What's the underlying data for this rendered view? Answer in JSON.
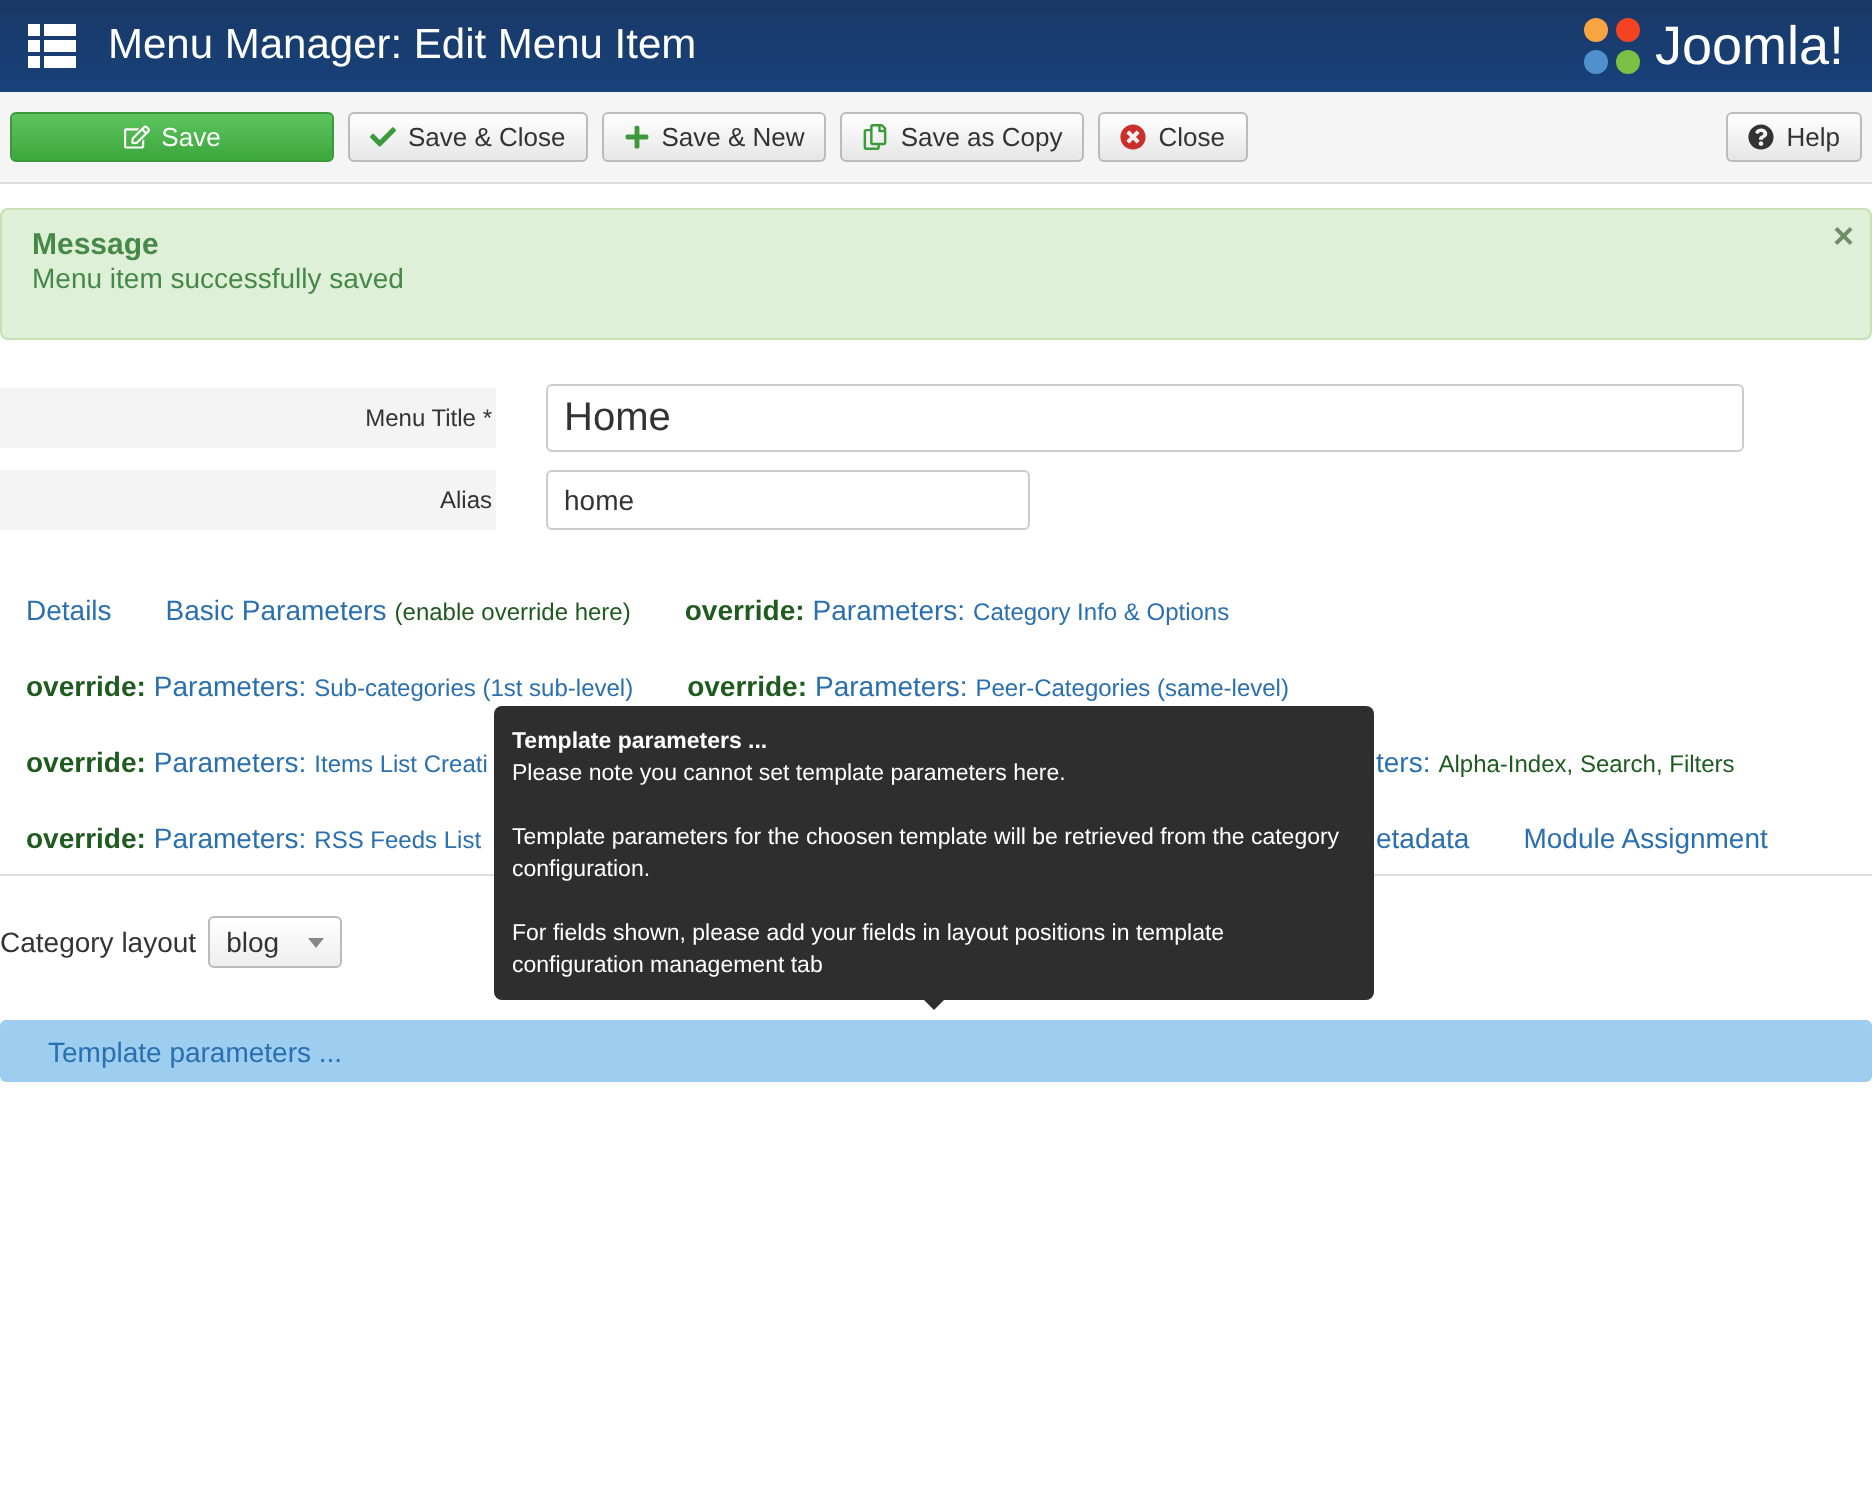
{
  "header": {
    "title": "Menu Manager: Edit Menu Item",
    "logo_text": "Joomla!"
  },
  "toolbar": {
    "buttons": [
      {
        "kind": "save",
        "label": "Save"
      },
      {
        "kind": "save-close",
        "label": "Save & Close"
      },
      {
        "kind": "save-new",
        "label": "Save & New"
      },
      {
        "kind": "copy",
        "label": "Save as Copy"
      },
      {
        "kind": "close",
        "label": "Close"
      }
    ],
    "help": {
      "label": "Help"
    }
  },
  "message": {
    "heading": "Message",
    "text": "Menu item successfully saved",
    "close": "×"
  },
  "fields": [
    {
      "label": "Menu Title *",
      "value": "Home"
    },
    {
      "label": "Alias",
      "value": "home"
    }
  ],
  "tab_rows": [
    [
      {
        "label": "Details"
      },
      {
        "label": "Basic Parameters",
        "detail": "(enable override here)"
      },
      {
        "prefix": "override:",
        "label": "Parameters:",
        "detail": "Category Info & Options"
      }
    ],
    [
      {
        "prefix": "override:",
        "label": "Parameters:",
        "detail": "Sub-categories (1st sub-level)"
      },
      {
        "prefix": "override:",
        "label": "Parameters:",
        "detail": "Peer-Categories (same-level)"
      }
    ],
    [
      {
        "prefix": "override:",
        "label": "Parameters:",
        "detail": "Items List Creati"
      },
      {
        "label": "ters:",
        "detail": "Alpha-Index, Search, Filters"
      }
    ],
    [
      {
        "prefix": "override:",
        "label": "Parameters:",
        "detail": "RSS Feeds List"
      },
      {
        "label": "etadata"
      },
      {
        "label": "Module Assignment"
      }
    ]
  ],
  "layout_select": {
    "label": "Category layout",
    "value": "blog"
  },
  "section_bar": {
    "label": "Template parameters ..."
  },
  "tooltip": {
    "title": "Template parameters ...",
    "paragraphs": [
      "Please note you cannot set template parameters here.",
      "Template parameters for the choosen template will be retrieved from the category configuration.",
      "For fields shown, please add your fields in layout positions in template configuration management tab"
    ]
  }
}
